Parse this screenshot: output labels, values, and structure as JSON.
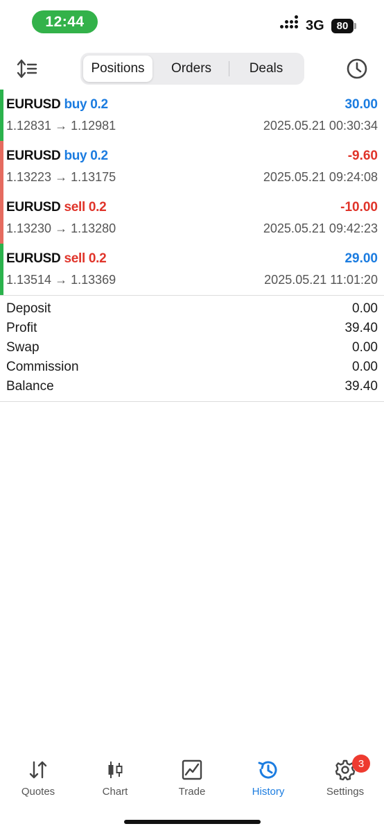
{
  "status_bar": {
    "time": "12:44",
    "network": "3G",
    "battery": "80"
  },
  "toolbar": {
    "tabs": [
      {
        "label": "Positions",
        "active": true
      },
      {
        "label": "Orders",
        "active": false
      },
      {
        "label": "Deals",
        "active": false
      }
    ]
  },
  "deals": [
    {
      "symbol": "EURUSD",
      "side": "buy 0.2",
      "side_color": "blue",
      "profit": "30.00",
      "profit_color": "blue",
      "prices": "1.12831 → 1.12981",
      "time": "2025.05.21 00:30:34",
      "bar_color": "#2bb24c"
    },
    {
      "symbol": "EURUSD",
      "side": "buy 0.2",
      "side_color": "blue",
      "profit": "-9.60",
      "profit_color": "red",
      "prices": "1.13223 → 1.13175",
      "time": "2025.05.21 09:24:08",
      "bar_color": "#e56b5f"
    },
    {
      "symbol": "EURUSD",
      "side": "sell 0.2",
      "side_color": "red",
      "profit": "-10.00",
      "profit_color": "red",
      "prices": "1.13230 → 1.13280",
      "time": "2025.05.21 09:42:23",
      "bar_color": "#e56b5f"
    },
    {
      "symbol": "EURUSD",
      "side": "sell 0.2",
      "side_color": "red",
      "profit": "29.00",
      "profit_color": "blue",
      "prices": "1.13514 → 1.13369",
      "time": "2025.05.21 11:01:20",
      "bar_color": "#2bb24c"
    }
  ],
  "summary": [
    {
      "label": "Deposit",
      "value": "0.00"
    },
    {
      "label": "Profit",
      "value": "39.40"
    },
    {
      "label": "Swap",
      "value": "0.00"
    },
    {
      "label": "Commission",
      "value": "0.00"
    },
    {
      "label": "Balance",
      "value": "39.40"
    }
  ],
  "tabbar": {
    "items": [
      {
        "label": "Quotes",
        "icon": "quotes-icon"
      },
      {
        "label": "Chart",
        "icon": "chart-icon"
      },
      {
        "label": "Trade",
        "icon": "trade-icon"
      },
      {
        "label": "History",
        "icon": "history-icon",
        "active": true
      },
      {
        "label": "Settings",
        "icon": "gear-icon"
      }
    ],
    "settings_badge": "3"
  },
  "colors": {
    "accent_blue": "#1b7ce0",
    "loss_red": "#e0342a",
    "profit_bar_green": "#2bb24c",
    "loss_bar_red": "#e56b5f",
    "status_pill_green": "#33b24a"
  }
}
